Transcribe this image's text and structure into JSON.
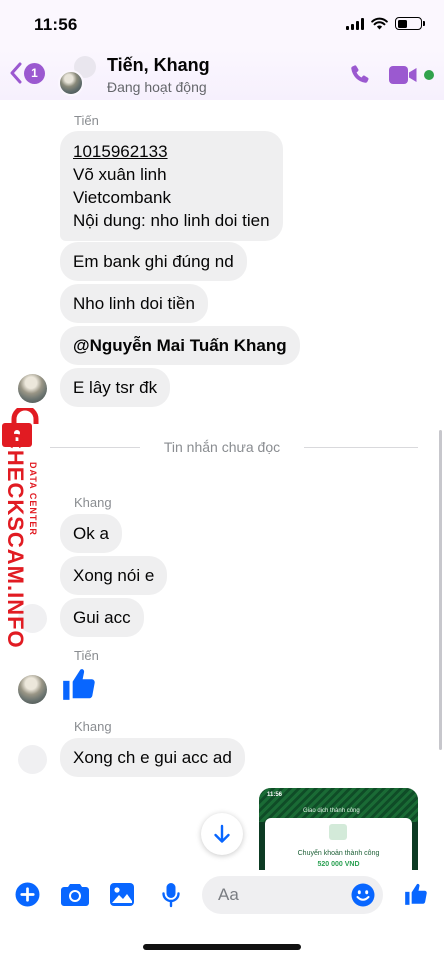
{
  "status_bar": {
    "time": "11:56",
    "battery_level": 0.45
  },
  "header": {
    "back_badge": "1",
    "contact_name": "Tiến, Khang",
    "contact_status": "Đang hoạt động",
    "accent_color": "#9b59d0",
    "online_color": "#31a24c"
  },
  "messages": {
    "sender_tien_1": "Tiến",
    "bank_account": "1015962133",
    "bank_name_person": "Võ xuân linh",
    "bank_name": "Vietcombank",
    "bank_content": "Nội dung: nho linh doi tien",
    "msg_2": "Em bank ghi đúng nd",
    "msg_3": "Nho linh doi tiền",
    "msg_4_mention": "@Nguyễn Mai Tuấn Khang",
    "msg_5": "E lây tsr đk",
    "unread_divider": "Tin nhắn chưa đọc",
    "sender_khang_1": "Khang",
    "msg_6": "Ok a",
    "msg_7": "Xong nói e",
    "msg_8": "Gui acc",
    "sender_tien_2": "Tiến",
    "sender_khang_2": "Khang",
    "msg_9": "Xong ch e gui acc ad"
  },
  "shared_image": {
    "time": "11:56",
    "title": "Giao dịch thành công",
    "main_text": "Chuyển khoản thành công",
    "amount": "520 000 VND"
  },
  "watermark": {
    "main": "CHECKSCAM.INFO",
    "sub": "DATA CENTER"
  },
  "composer": {
    "placeholder": "Aa"
  },
  "icons": {
    "back": "chevron-left-icon",
    "call": "phone-icon",
    "video": "video-camera-icon",
    "add": "plus-circle-icon",
    "camera": "camera-icon",
    "gallery": "image-icon",
    "mic": "microphone-icon",
    "emoji": "smiley-icon",
    "like": "thumbs-up-icon",
    "scroll": "arrow-down-icon"
  },
  "colors": {
    "messenger_blue": "#0866ff",
    "watermark_red": "#e11b22"
  }
}
